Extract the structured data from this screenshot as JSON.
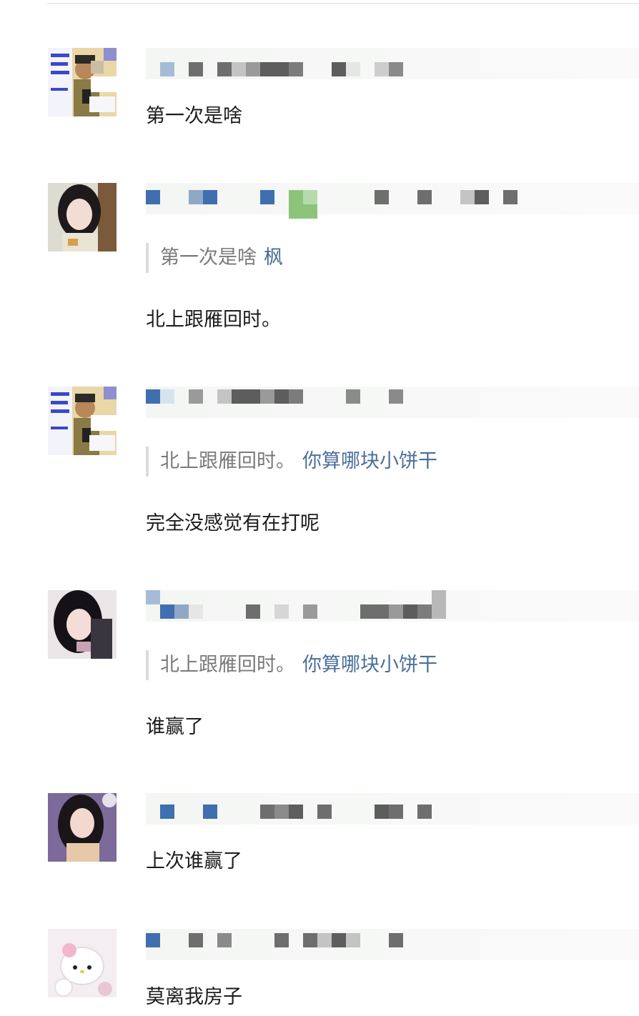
{
  "comments": [
    {
      "text": "第一次是啥",
      "quote": null
    },
    {
      "text": "北上跟雁回时。",
      "quote": {
        "text": "第一次是啥",
        "author": "枫"
      }
    },
    {
      "text": "完全没感觉有在打呢",
      "quote": {
        "text": "北上跟雁回时。",
        "author": "你算哪块小饼干"
      }
    },
    {
      "text": "谁赢了",
      "quote": {
        "text": "北上跟雁回时。",
        "author": "你算哪块小饼干"
      }
    },
    {
      "text": "上次谁赢了",
      "quote": null
    },
    {
      "text": "莫离我房子",
      "quote": null
    }
  ],
  "colors": {
    "quote_author": "#4a6f9a",
    "quote_text": "#7a7a7a",
    "body_text": "#1c1c1c",
    "pixel_blue": "#3f6fae",
    "pixel_gray": "#6e6e6e",
    "pixel_green": "#8cc47a"
  }
}
